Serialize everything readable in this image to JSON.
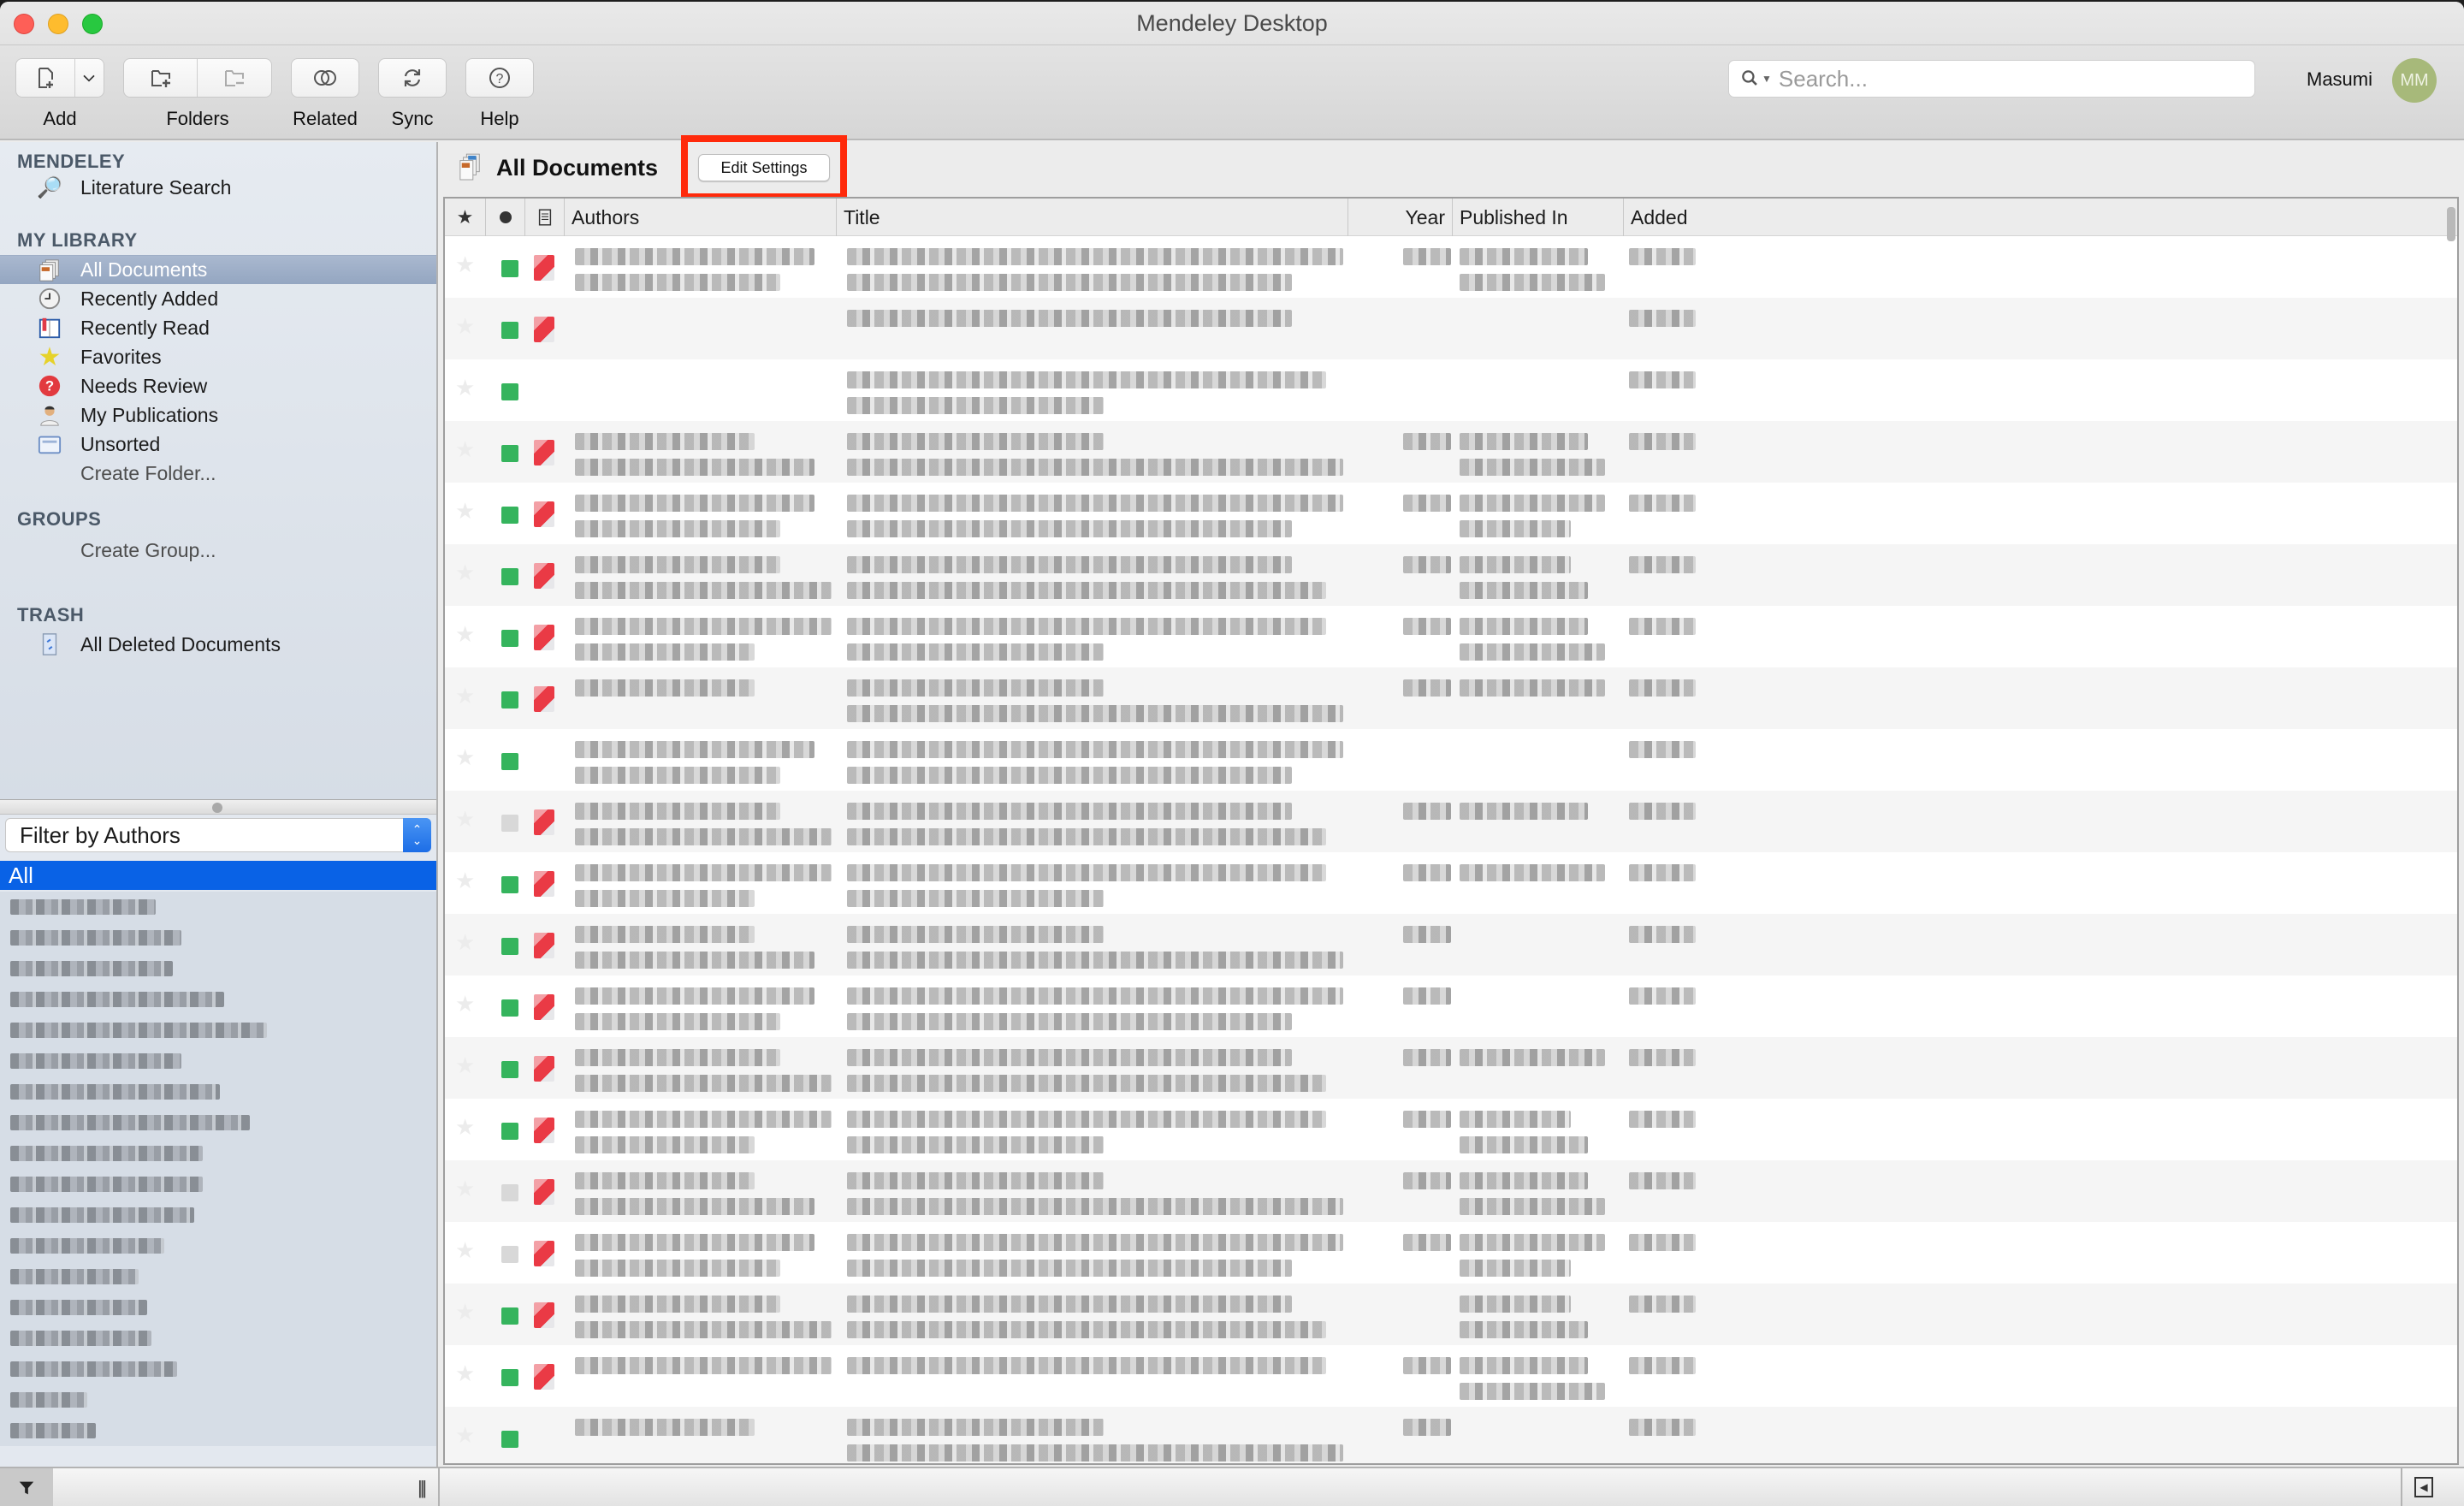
{
  "window": {
    "title": "Mendeley Desktop"
  },
  "toolbar": {
    "add_label": "Add",
    "folders_label": "Folders",
    "related_label": "Related",
    "sync_label": "Sync",
    "help_label": "Help",
    "search_placeholder": "Search...",
    "user_name": "Masumi",
    "avatar_initials": "MM",
    "avatar_color": "#a7b97a"
  },
  "sidebar": {
    "sections": {
      "mendeley": "MENDELEY",
      "my_library": "MY LIBRARY",
      "groups": "GROUPS",
      "trash": "TRASH"
    },
    "mendeley_items": [
      {
        "label": "Literature Search",
        "icon": "magnifier-icon"
      }
    ],
    "library_items": [
      {
        "label": "All Documents",
        "icon": "documents-icon",
        "selected": true
      },
      {
        "label": "Recently Added",
        "icon": "clock-icon"
      },
      {
        "label": "Recently Read",
        "icon": "book-icon"
      },
      {
        "label": "Favorites",
        "icon": "star-icon"
      },
      {
        "label": "Needs Review",
        "icon": "question-icon"
      },
      {
        "label": "My Publications",
        "icon": "person-icon"
      },
      {
        "label": "Unsorted",
        "icon": "inbox-icon"
      }
    ],
    "create_folder": "Create Folder...",
    "create_group": "Create Group...",
    "trash_items": [
      {
        "label": "All Deleted Documents",
        "icon": "trash-icon"
      }
    ],
    "filter": {
      "selected": "Filter by Authors",
      "all_label": "All",
      "authors_redacted": true,
      "author_count_visible": 19
    }
  },
  "main": {
    "title": "All Documents",
    "edit_settings_label": "Edit Settings",
    "highlight_color": "#ff2a0b",
    "columns": [
      "Authors",
      "Title",
      "Year",
      "Published In",
      "Added"
    ],
    "column_icons": [
      "star-icon",
      "read-status-icon",
      "file-icon"
    ],
    "rows_redacted": true,
    "rows": [
      {
        "read": "green",
        "pdf": true,
        "authors": 2,
        "title": 2,
        "year": true,
        "pub": 2,
        "added": true
      },
      {
        "read": "green",
        "pdf": true,
        "authors": 0,
        "title": 1,
        "year": false,
        "pub": 0,
        "added": true
      },
      {
        "read": "green",
        "pdf": false,
        "authors": 0,
        "title": 2,
        "year": false,
        "pub": 0,
        "added": true
      },
      {
        "read": "green",
        "pdf": true,
        "authors": 2,
        "title": 2,
        "year": true,
        "pub": 2,
        "added": true
      },
      {
        "read": "green",
        "pdf": true,
        "authors": 2,
        "title": 2,
        "year": true,
        "pub": 2,
        "added": true
      },
      {
        "read": "green",
        "pdf": true,
        "authors": 2,
        "title": 2,
        "year": true,
        "pub": 2,
        "added": true
      },
      {
        "read": "green",
        "pdf": true,
        "authors": 2,
        "title": 2,
        "year": true,
        "pub": 2,
        "added": true
      },
      {
        "read": "green",
        "pdf": true,
        "authors": 1,
        "title": 2,
        "year": true,
        "pub": 1,
        "added": true
      },
      {
        "read": "green",
        "pdf": false,
        "authors": 2,
        "title": 2,
        "year": false,
        "pub": 0,
        "added": true
      },
      {
        "read": "grey",
        "pdf": true,
        "authors": 2,
        "title": 2,
        "year": true,
        "pub": 1,
        "added": true
      },
      {
        "read": "green",
        "pdf": true,
        "authors": 2,
        "title": 2,
        "year": true,
        "pub": 1,
        "added": true
      },
      {
        "read": "green",
        "pdf": true,
        "authors": 2,
        "title": 2,
        "year": true,
        "pub": 0,
        "added": true
      },
      {
        "read": "green",
        "pdf": true,
        "authors": 2,
        "title": 2,
        "year": true,
        "pub": 0,
        "added": true
      },
      {
        "read": "green",
        "pdf": true,
        "authors": 2,
        "title": 2,
        "year": true,
        "pub": 1,
        "added": true
      },
      {
        "read": "green",
        "pdf": true,
        "authors": 2,
        "title": 2,
        "year": true,
        "pub": 2,
        "added": true
      },
      {
        "read": "grey",
        "pdf": true,
        "authors": 2,
        "title": 2,
        "year": true,
        "pub": 2,
        "added": true
      },
      {
        "read": "grey",
        "pdf": true,
        "authors": 2,
        "title": 2,
        "year": true,
        "pub": 2,
        "added": true
      },
      {
        "read": "green",
        "pdf": true,
        "authors": 2,
        "title": 2,
        "year": false,
        "pub": 2,
        "added": true
      },
      {
        "read": "green",
        "pdf": true,
        "authors": 1,
        "title": 1,
        "year": true,
        "pub": 2,
        "added": true
      },
      {
        "read": "green",
        "pdf": false,
        "authors": 1,
        "title": 2,
        "year": true,
        "pub": 0,
        "added": true
      }
    ]
  },
  "colors": {
    "read_green": "#35b45d",
    "read_grey": "#d8d8d8",
    "pdf_red": "#ea3a45",
    "selection_blue": "#0962e6",
    "sidebar_selected": "#9aabc4"
  }
}
